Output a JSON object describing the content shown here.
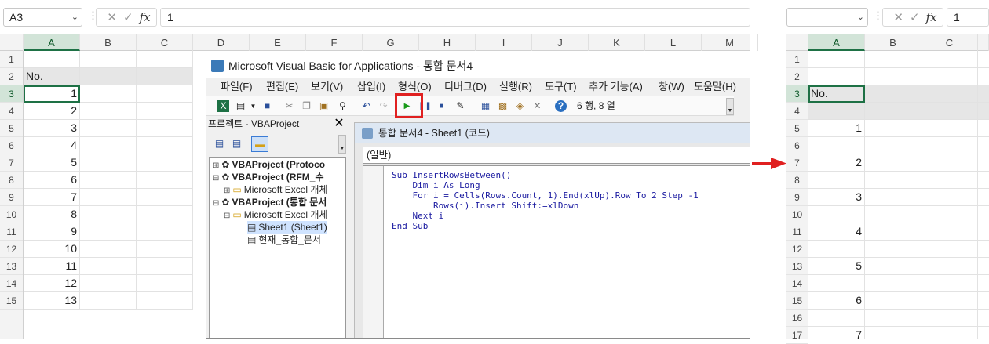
{
  "left_excel": {
    "name_box": "A3",
    "formula_value": "1",
    "columns": [
      "A",
      "B",
      "C",
      "D",
      "E",
      "F",
      "G",
      "H",
      "I",
      "J",
      "K",
      "L",
      "M"
    ],
    "rows": [
      "1",
      "2",
      "3",
      "4",
      "5",
      "6",
      "7",
      "8",
      "9",
      "10",
      "11",
      "12",
      "13",
      "14",
      "15"
    ],
    "header_cell": "No.",
    "values": [
      "1",
      "2",
      "3",
      "4",
      "5",
      "6",
      "7",
      "8",
      "9",
      "10",
      "11",
      "12",
      "13",
      "14",
      "15"
    ]
  },
  "vbe": {
    "title": "Microsoft Visual Basic for Applications - 통합 문서4",
    "menu": [
      "파일(F)",
      "편집(E)",
      "보기(V)",
      "삽입(I)",
      "형식(O)",
      "디버그(D)",
      "실행(R)",
      "도구(T)",
      "추가 기능(A)",
      "창(W)",
      "도움말(H)"
    ],
    "position_text": "6 행, 8 열",
    "project_title": "프로젝트 - VBAProject",
    "tree": [
      "VBAProject (Protoco",
      "VBAProject (RFM_수",
      "Microsoft Excel 개체",
      "VBAProject (통합 문서",
      "Microsoft Excel 개체",
      "Sheet1 (Sheet1)",
      "현재_통합_문서"
    ],
    "code_title": "통합 문서4 - Sheet1 (코드)",
    "combo": "(일반)",
    "code": [
      "Sub InsertRowsBetween()",
      "    Dim i As Long",
      "    For i = Cells(Rows.Count, 1).End(xlUp).Row To 2 Step -1",
      "        Rows(i).Insert Shift:=xlDown",
      "    Next i",
      "End Sub"
    ]
  },
  "right_excel": {
    "name_box": "",
    "formula_value": "1",
    "columns": [
      "A",
      "B",
      "C"
    ],
    "rows": [
      "1",
      "2",
      "3",
      "4",
      "5",
      "6",
      "7",
      "8",
      "9",
      "10",
      "11",
      "12",
      "13",
      "14",
      "15",
      "16",
      "17"
    ],
    "header_cell": "No.",
    "values": [
      "1",
      "2",
      "3",
      "4",
      "5",
      "6",
      "7"
    ]
  },
  "colors": {
    "excel_green": "#1e7145",
    "highlight_red": "#e02020",
    "run_green": "#1a9a1a"
  }
}
